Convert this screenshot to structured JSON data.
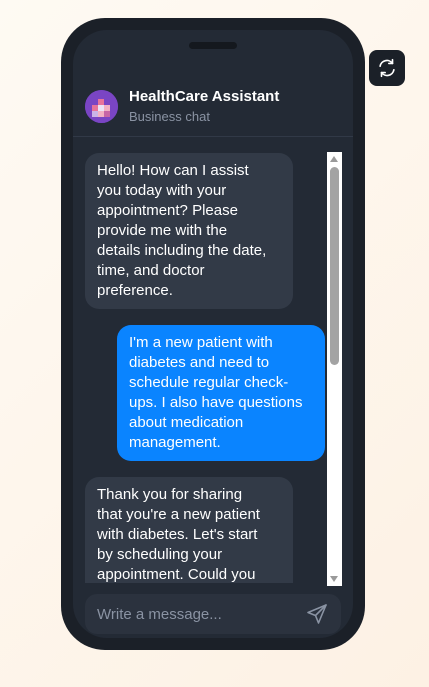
{
  "header": {
    "name": "HealthCare Assistant",
    "subtitle": "Business chat"
  },
  "messages": [
    {
      "role": "assistant",
      "text": "Hello! How can I assist\nyou today with your\nappointment? Please\nprovide me with the\ndetails including the date,\ntime, and doctor\npreference."
    },
    {
      "role": "user",
      "text": "I'm a new patient with\ndiabetes and need to\nschedule regular check-\nups. I also have questions\nabout medication\nmanagement."
    },
    {
      "role": "assistant",
      "text": "Thank you for sharing\nthat you're a new patient\nwith diabetes. Let's start\nby scheduling your\nappointment. Could you"
    }
  ],
  "composer": {
    "placeholder": "Write a message..."
  },
  "icons": {
    "send": "send-icon",
    "refresh": "refresh-icon",
    "avatar": "avatar"
  },
  "colors": {
    "user_bubble": "#0a84ff",
    "assistant_bubble": "#323a47",
    "screen_bg": "#232a35"
  }
}
